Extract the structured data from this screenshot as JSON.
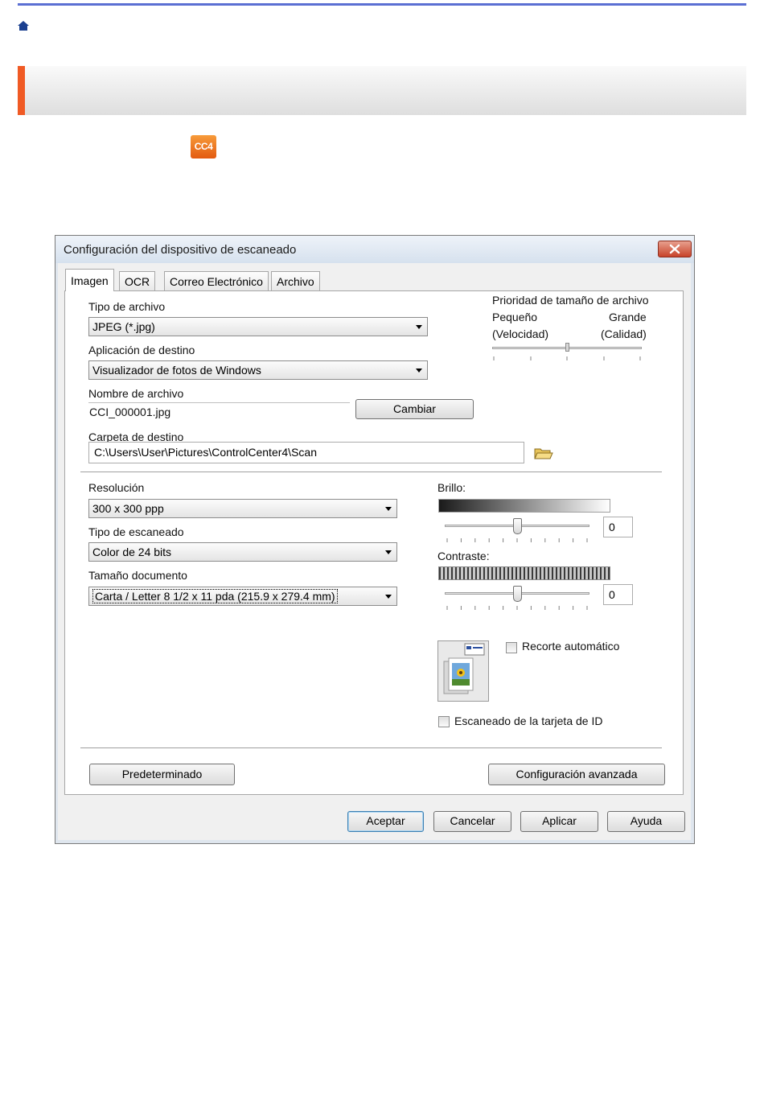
{
  "dialog": {
    "title": "Configuración del dispositivo de escaneado",
    "tabs": [
      {
        "label": "Imagen",
        "active": true
      },
      {
        "label": "OCR",
        "active": false
      },
      {
        "label": "Correo Electrónico",
        "active": false
      },
      {
        "label": "Archivo",
        "active": false
      }
    ]
  },
  "file_type": {
    "label": "Tipo de archivo",
    "value": "JPEG (*.jpg)"
  },
  "target_app": {
    "label": "Aplicación de destino",
    "value": "Visualizador de fotos de Windows"
  },
  "file_name": {
    "label": "Nombre de archivo",
    "value": "CCI_000001.jpg",
    "change_button": "Cambiar"
  },
  "dest_folder": {
    "label": "Carpeta de destino",
    "value": "C:\\Users\\User\\Pictures\\ControlCenter4\\Scan"
  },
  "size_priority": {
    "label": "Prioridad de tamaño de archivo",
    "small": "Pequeño",
    "speed": "(Velocidad)",
    "large": "Grande",
    "quality": "(Calidad)",
    "level": 0.5
  },
  "resolution": {
    "label": "Resolución",
    "value": "300 x 300 ppp"
  },
  "scan_type": {
    "label": "Tipo de escaneado",
    "value": "Color de 24 bits"
  },
  "doc_size": {
    "label": "Tamaño documento",
    "value": "Carta / Letter 8 1/2 x 11 pda (215.9 x 279.4 mm)"
  },
  "brightness": {
    "label": "Brillo:",
    "value": "0",
    "level": 0.5
  },
  "contrast": {
    "label": "Contraste:",
    "value": "0",
    "level": 0.5
  },
  "auto_crop": {
    "label": "Recorte automático",
    "checked": false
  },
  "id_card": {
    "label": "Escaneado de la tarjeta de ID",
    "checked": false
  },
  "buttons": {
    "default": "Predeterminado",
    "advanced": "Configuración avanzada",
    "ok": "Aceptar",
    "cancel": "Cancelar",
    "apply": "Aplicar",
    "help": "Ayuda"
  },
  "colors": {
    "accent": "#f05a24",
    "rule": "#5b6fd3"
  }
}
